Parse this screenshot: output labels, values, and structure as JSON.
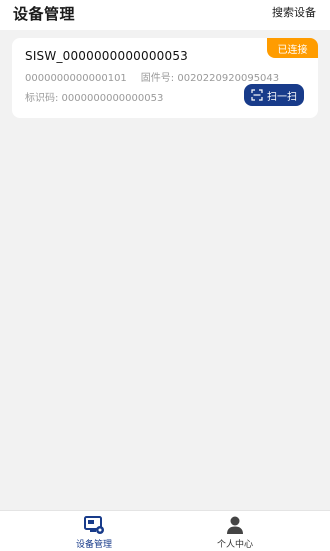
{
  "header": {
    "title": "设备管理",
    "search_label": "搜索设备"
  },
  "device": {
    "status": "已连接",
    "name": "SISW_0000000000000053",
    "number": "0000000000000101",
    "firmware_label": "固件号: 0020220920095043",
    "identifier_label": "标识码: 0000000000000053",
    "scan_label": "扫一扫"
  },
  "tabbar": {
    "devices_label": "设备管理",
    "profile_label": "个人中心"
  },
  "colors": {
    "accent": "#183b8a",
    "badge": "#ff9c00",
    "background": "#f2f2f2"
  }
}
